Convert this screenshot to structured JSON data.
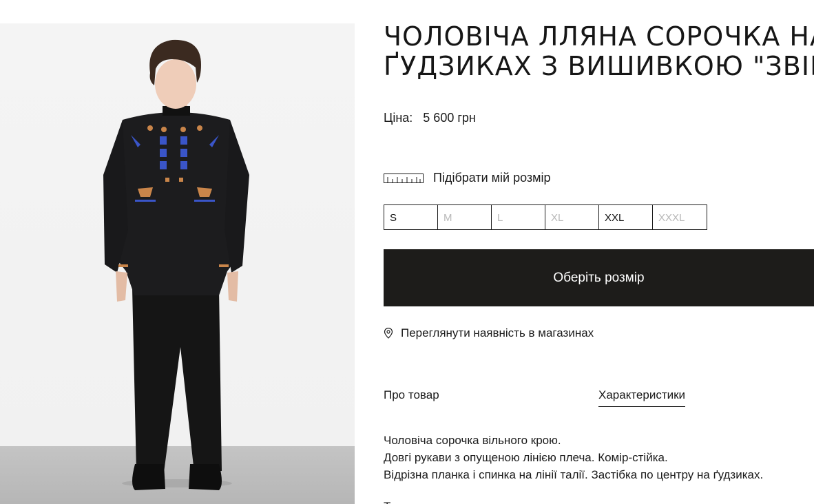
{
  "product": {
    "title_line1": "ЧОЛОВІЧА ЛЛЯНА СОРОЧКА НА",
    "title_line2": "ҐУДЗИКАХ З ВИШИВКОЮ \"ЗВІР\"",
    "price_label": "Ціна:",
    "price_value": "5 600 грн",
    "image_alt": "Чоловіча лляна сорочка на ґудзиках з вишивкою Звір"
  },
  "size_guide": {
    "label": "Підібрати мій розмір",
    "icon": "ruler-icon"
  },
  "sizes": [
    {
      "label": "S",
      "available": true
    },
    {
      "label": "M",
      "available": false
    },
    {
      "label": "L",
      "available": false
    },
    {
      "label": "XL",
      "available": false
    },
    {
      "label": "XXL",
      "available": true
    },
    {
      "label": "XXXL",
      "available": false
    }
  ],
  "cta": {
    "label": "Оберіть розмір"
  },
  "stores": {
    "label": "Переглянути наявність в магазинах",
    "icon": "location-pin-icon"
  },
  "tabs": [
    {
      "label": "Про товар",
      "active": false
    },
    {
      "label": "Характеристики",
      "active": true
    }
  ],
  "description": {
    "line1": "Чоловіча сорочка вільного крою.",
    "line2": "Довгі рукави з опущеною лінією плеча. Комір-стійка.",
    "line3": "Відрізна планка і спинка на лінії талії. Застібка по центру на ґудзиках.",
    "line4": "Т"
  },
  "colors": {
    "button_bg": "#1d1c1a",
    "text": "#1a1a1a",
    "unavailable_size": "#b8b8b8",
    "embroidery_blue": "#3a55c8",
    "embroidery_orange": "#c9854a"
  }
}
